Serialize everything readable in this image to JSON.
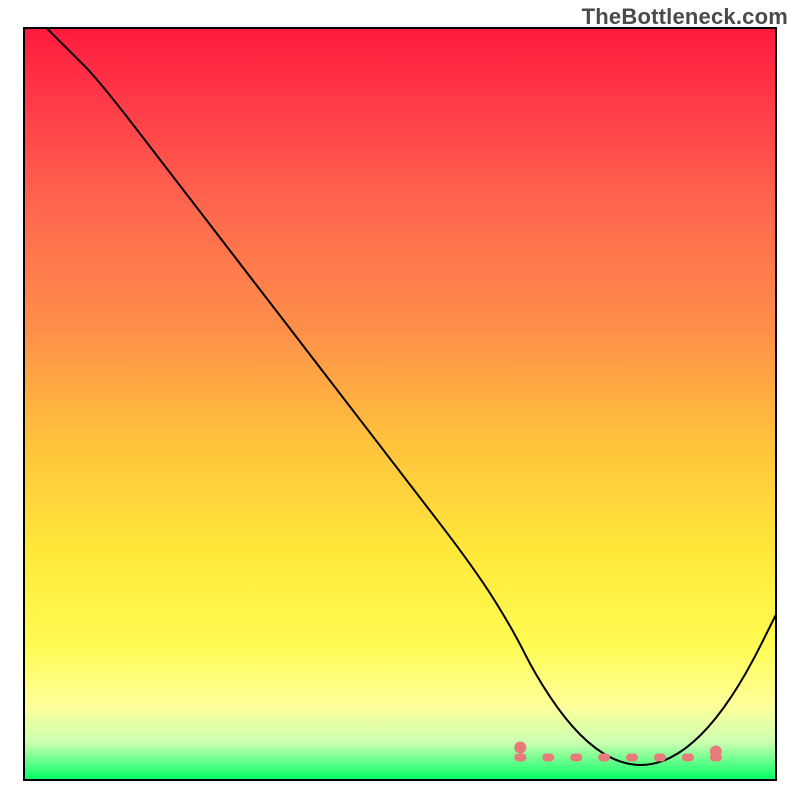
{
  "watermark": "TheBottleneck.com",
  "chart_data": {
    "type": "line",
    "title": "",
    "xlabel": "",
    "ylabel": "",
    "xlim": [
      0,
      100
    ],
    "ylim": [
      0,
      100
    ],
    "series": [
      {
        "name": "curve",
        "x": [
          3,
          6,
          10,
          20,
          30,
          40,
          50,
          60,
          65,
          68,
          72,
          76,
          80,
          84,
          88,
          92,
          96,
          100
        ],
        "y": [
          100,
          97,
          93,
          80,
          67,
          54,
          41,
          28,
          20,
          14,
          8,
          4,
          2,
          2,
          4,
          8,
          14,
          22
        ]
      }
    ],
    "highlight_band": {
      "y_from": 0,
      "y_to": 5,
      "color": "#00ff66"
    },
    "flat_region_markers": {
      "x_from": 66,
      "x_to": 92,
      "y": 3,
      "color": "#e77a7a"
    },
    "gradient_stops": [
      {
        "offset": 0.0,
        "color": "#ff1a3d"
      },
      {
        "offset": 0.1,
        "color": "#ff3b49"
      },
      {
        "offset": 0.25,
        "color": "#ff6a4e"
      },
      {
        "offset": 0.4,
        "color": "#ff8f4a"
      },
      {
        "offset": 0.55,
        "color": "#ffc23c"
      },
      {
        "offset": 0.7,
        "color": "#ffe93a"
      },
      {
        "offset": 0.82,
        "color": "#fffb53"
      },
      {
        "offset": 0.9,
        "color": "#ffff9a"
      },
      {
        "offset": 0.95,
        "color": "#ccffb0"
      },
      {
        "offset": 1.0,
        "color": "#00ff66"
      }
    ]
  }
}
